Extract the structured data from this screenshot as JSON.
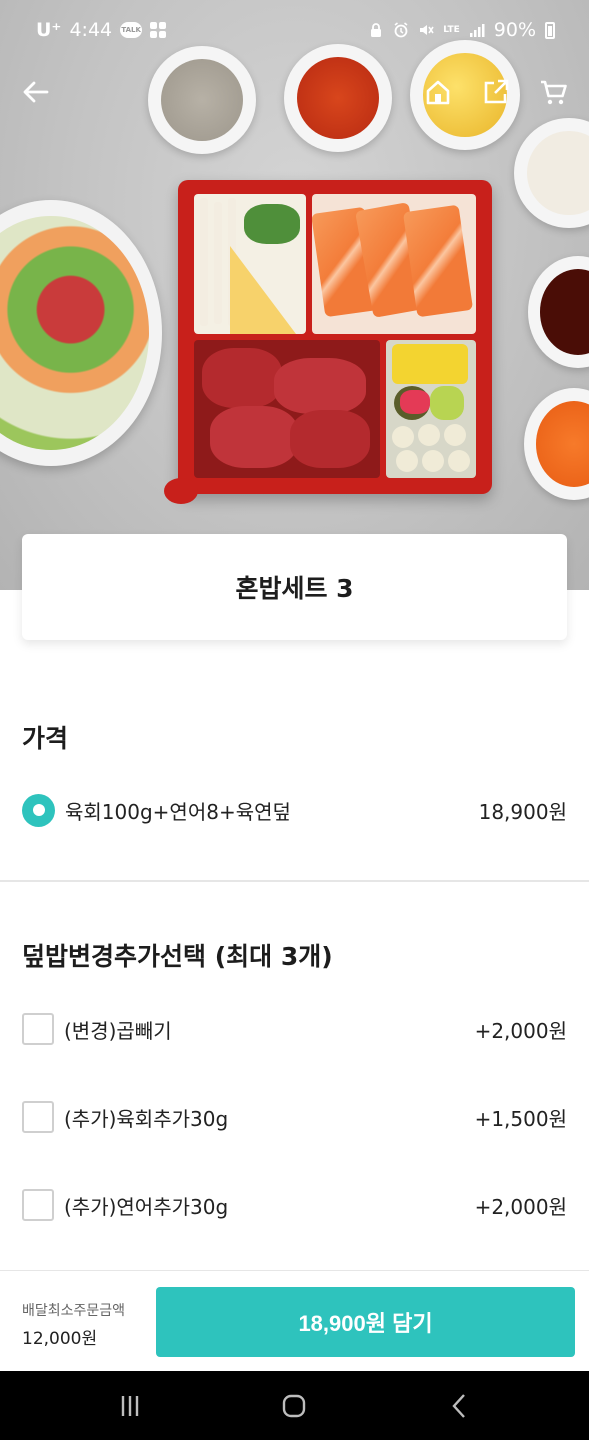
{
  "status_bar": {
    "carrier": "U⁺",
    "time": "4:44",
    "talk_badge": "TALK",
    "network": "LTE",
    "battery": "90%"
  },
  "header": {
    "back_icon": "arrow-left-icon",
    "home_icon": "home-icon",
    "share_icon": "share-icon",
    "cart_icon": "cart-icon"
  },
  "product": {
    "name": "혼밥세트 3"
  },
  "price_section": {
    "title": "가격",
    "options": [
      {
        "label": "육회100g+연어8+육연덮",
        "price": "18,900원",
        "selected": true
      }
    ]
  },
  "addon_section": {
    "title": "덮밥변경추가선택 (최대 3개)",
    "options": [
      {
        "label": "(변경)곱빼기",
        "price": "+2,000원",
        "checked": false
      },
      {
        "label": "(추가)육회추가30g",
        "price": "+1,500원",
        "checked": false
      },
      {
        "label": "(추가)연어추가30g",
        "price": "+2,000원",
        "checked": false
      }
    ]
  },
  "bottom_bar": {
    "min_order_label": "배달최소주문금액",
    "min_order_value": "12,000원",
    "cart_button": "18,900원 담기"
  },
  "theme": {
    "accent": "#2ec3bd"
  }
}
